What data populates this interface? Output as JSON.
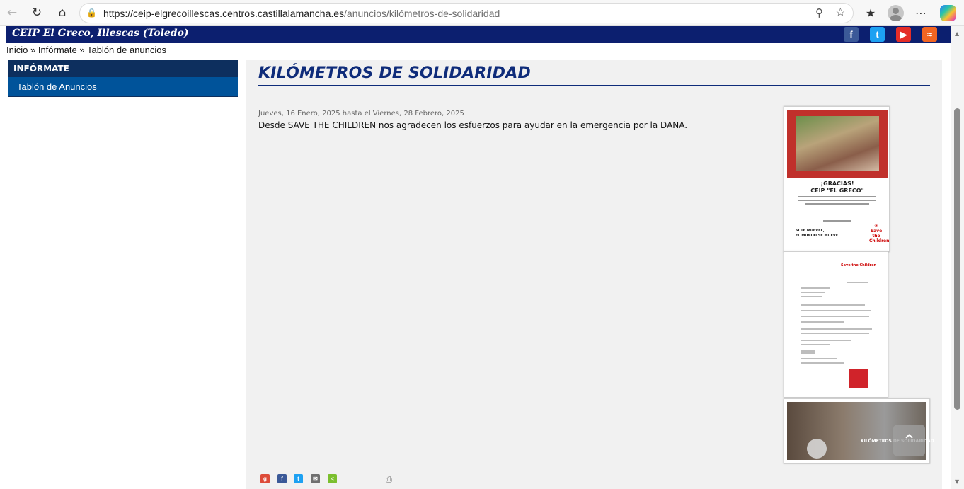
{
  "browser": {
    "url_host": "https://ceip-elgrecoillescas.centros.castillalamancha.es",
    "url_path": "/anuncios/kilómetros-de-solidaridad"
  },
  "site": {
    "title": "CEIP El Greco, Illescas (Toledo)",
    "social": [
      "facebook-icon",
      "twitter-icon",
      "youtube-icon",
      "rss-icon"
    ]
  },
  "breadcrumb": {
    "home": "Inicio",
    "sep1": " » ",
    "section": "Infórmate",
    "sep2": " » ",
    "current": "Tablón de anuncios"
  },
  "sidebar": {
    "heading": "INFÓRMATE",
    "items": [
      {
        "label": "Tablón de Anuncios"
      }
    ]
  },
  "article": {
    "title": "KILÓMETROS DE SOLIDARIDAD",
    "date": "Jueves, 16 Enero, 2025 hasta el Viernes, 28 Febrero, 2025",
    "body": "Desde SAVE THE CHILDREN nos agradecen los esfuerzos para ayudar en la emergencia por la DANA."
  },
  "images": {
    "poster_line1": "¡GRACIAS!",
    "poster_line2": "CEIP \"EL GRECO\"",
    "poster_slogan_1": "SI TE MUEVEL,",
    "poster_slogan_2": "EL MUNDO SE MUEVE",
    "brand": "Save the Children",
    "video_title": "KILÓMETROS DE SOLIDARIDAD"
  },
  "colors": {
    "banner": "#0c1f6f",
    "sidebar_head": "#0d2f5e",
    "sidebar_item": "#00539a",
    "title": "#0f2c7a"
  }
}
